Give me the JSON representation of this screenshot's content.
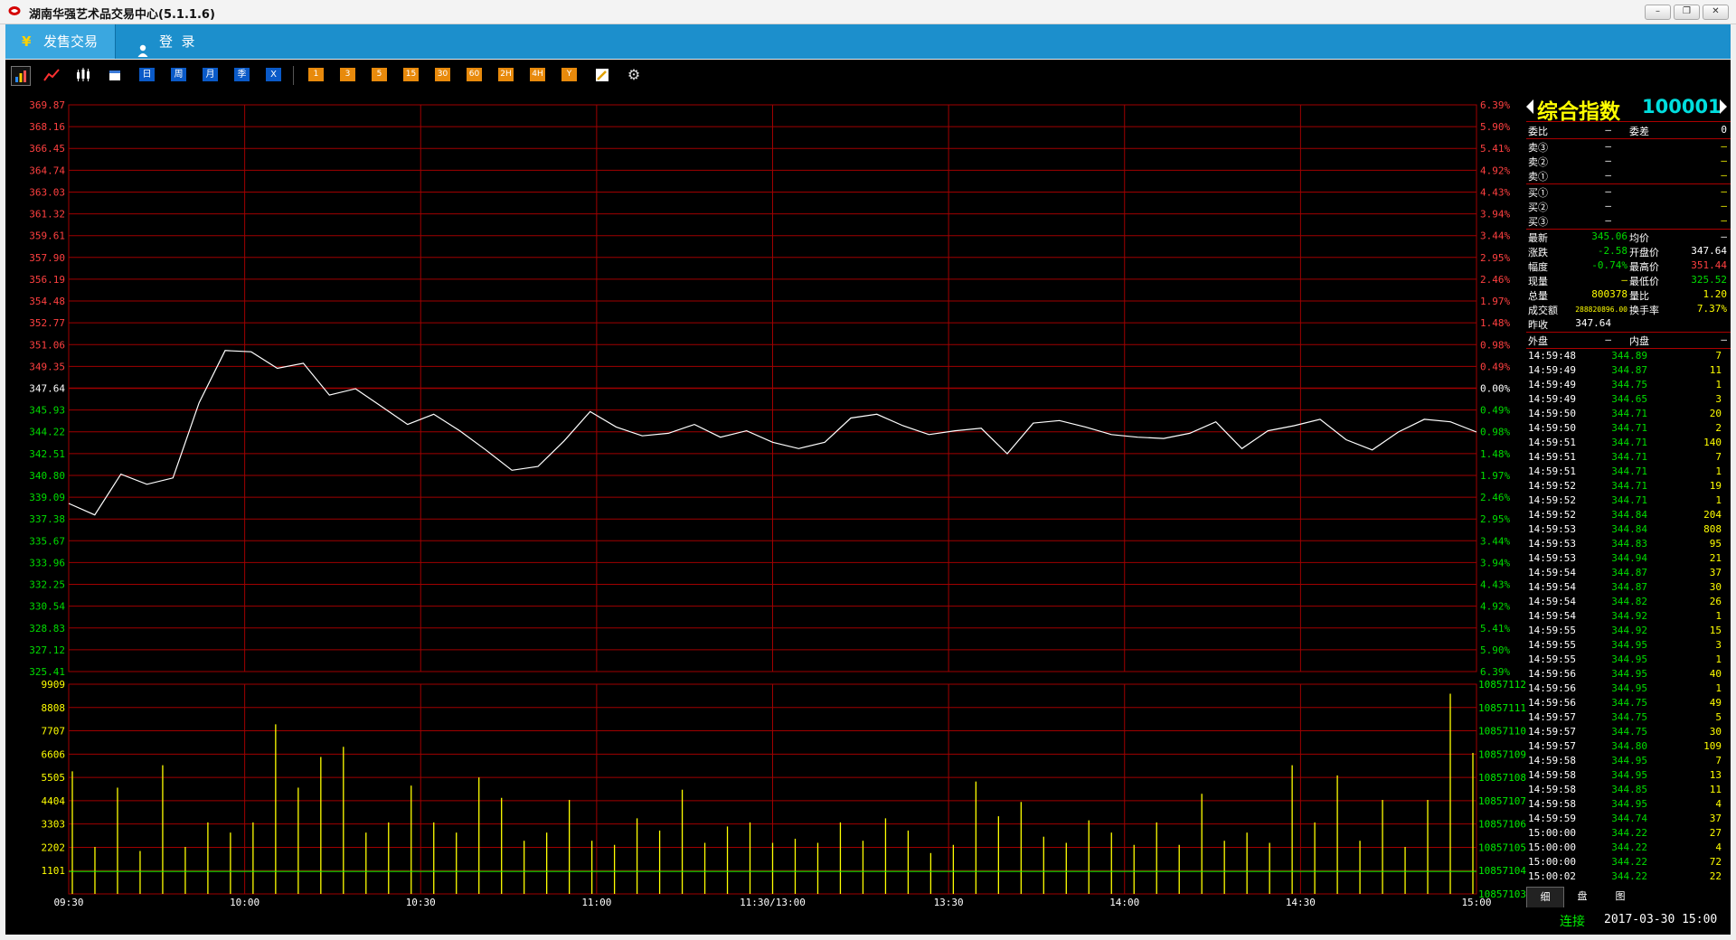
{
  "window": {
    "title": "湖南华强艺术品交易中心(5.1.1.6)",
    "controls": [
      "–",
      "❐",
      "✕"
    ]
  },
  "tabs": [
    {
      "label": "发售交易",
      "icon": "yen-icon"
    },
    {
      "label": "登  录",
      "icon": "user-icon"
    }
  ],
  "toolbar": {
    "period_buttons": [
      "日",
      "周",
      "月",
      "季",
      "X"
    ],
    "minute_buttons": [
      "1",
      "3",
      "5",
      "15",
      "30",
      "60",
      "2H",
      "4H",
      "Y"
    ]
  },
  "chart": {
    "price_ticks": [
      "369.87",
      "368.16",
      "366.45",
      "364.74",
      "363.03",
      "361.32",
      "359.61",
      "357.90",
      "356.19",
      "354.48",
      "352.77",
      "351.06",
      "349.35",
      "347.64",
      "345.93",
      "344.22",
      "342.51",
      "340.80",
      "339.09",
      "337.38",
      "335.67",
      "333.96",
      "332.25",
      "330.54",
      "328.83",
      "327.12",
      "325.41"
    ],
    "pct_ticks": [
      "6.39%",
      "5.90%",
      "5.41%",
      "4.92%",
      "4.43%",
      "3.94%",
      "3.44%",
      "2.95%",
      "2.46%",
      "1.97%",
      "1.48%",
      "0.98%",
      "0.49%",
      "0.00%",
      "0.49%",
      "0.98%",
      "1.48%",
      "1.97%",
      "2.46%",
      "2.95%",
      "3.44%",
      "3.94%",
      "4.43%",
      "4.92%",
      "5.41%",
      "5.90%",
      "6.39%"
    ],
    "vol_ticks": [
      "9909",
      "8808",
      "7707",
      "6606",
      "5505",
      "4404",
      "3303",
      "2202",
      "1101"
    ],
    "vol_right_ticks": [
      "10857112",
      "10857111",
      "10857110",
      "10857109",
      "10857108",
      "10857107",
      "10857106",
      "10857105",
      "10857104",
      "10857103"
    ],
    "time_ticks": [
      "09:30",
      "10:00",
      "10:30",
      "11:00",
      "11:30/13:00",
      "13:30",
      "14:00",
      "14:30",
      "15:00"
    ],
    "colors": {
      "up": "#ff4040",
      "down": "#00dd00",
      "flat": "#ffffff",
      "grid": "#a00000",
      "line": "#ffffff",
      "volume": "#ffff00",
      "volavg": "#00ff00"
    }
  },
  "chart_data": {
    "type": "line",
    "title": "综合指数 100001",
    "ylim": [
      325.41,
      369.87
    ],
    "prev_close": 347.64,
    "x": [
      "09:30",
      "10:00",
      "10:30",
      "11:00",
      "11:30/13:00",
      "13:30",
      "14:00",
      "14:30",
      "15:00"
    ],
    "series": [
      {
        "values": [
          338.6,
          337.7,
          340.9,
          340.1,
          340.6,
          346.5,
          350.6,
          350.5,
          349.2,
          349.6,
          347.1,
          347.6,
          346.2,
          344.8,
          345.6,
          344.3,
          342.8,
          341.2,
          341.5,
          343.5,
          345.8,
          344.6,
          343.9,
          344.1,
          344.8,
          343.8,
          344.3,
          343.4,
          342.9,
          343.4,
          345.3,
          345.6,
          344.7,
          344.0,
          344.3,
          344.5,
          342.5,
          344.9,
          345.1,
          344.6,
          344.0,
          343.8,
          343.7,
          344.1,
          345.0,
          342.9,
          344.3,
          344.7,
          345.2,
          343.6,
          342.8,
          344.2,
          345.2,
          345.0,
          344.2
        ]
      },
      {
        "name": "volume",
        "values": [
          6000,
          2300,
          5200,
          2100,
          6300,
          2300,
          3500,
          3000,
          3500,
          8300,
          5200,
          6700,
          7200,
          3000,
          3500,
          5300,
          3500,
          3000,
          5700,
          4700,
          2600,
          3000,
          4600,
          2600,
          2400,
          3700,
          3100,
          5100,
          2500,
          3300,
          3500,
          2500,
          2700,
          2500,
          3500,
          2600,
          3700,
          3100,
          2000,
          2400,
          5500,
          3800,
          4500,
          2800,
          2500,
          3600,
          3000,
          2400,
          3500,
          2400,
          4900,
          2600,
          3000,
          2500,
          6300,
          3500,
          5800,
          2600,
          4600,
          2300,
          4600,
          9800,
          6900
        ]
      }
    ]
  },
  "quote": {
    "title": "综合指数",
    "code": "100001",
    "wei": [
      {
        "k": "委比",
        "v": "—"
      },
      {
        "k": "委差",
        "v": "0"
      }
    ],
    "asks": [
      {
        "k": "卖③",
        "p": "—",
        "v": "—"
      },
      {
        "k": "卖②",
        "p": "—",
        "v": "—"
      },
      {
        "k": "卖①",
        "p": "—",
        "v": "—"
      }
    ],
    "bids": [
      {
        "k": "买①",
        "p": "—",
        "v": "—"
      },
      {
        "k": "买②",
        "p": "—",
        "v": "—"
      },
      {
        "k": "买③",
        "p": "—",
        "v": "—"
      }
    ],
    "stats": [
      {
        "k1": "最新",
        "v1": "345.06",
        "c1": "#00dd00",
        "k2": "均价",
        "v2": "—",
        "c2": "#fff"
      },
      {
        "k1": "涨跌",
        "v1": "-2.58",
        "c1": "#00dd00",
        "k2": "开盘价",
        "v2": "347.64",
        "c2": "#fff"
      },
      {
        "k1": "幅度",
        "v1": "-0.74%",
        "c1": "#00dd00",
        "k2": "最高价",
        "v2": "351.44",
        "c2": "#ff4040"
      },
      {
        "k1": "现量",
        "v1": "—",
        "c1": "#ffff00",
        "k2": "最低价",
        "v2": "325.52",
        "c2": "#00dd00"
      },
      {
        "k1": "总量",
        "v1": "800378",
        "c1": "#ffff00",
        "k2": "量比",
        "v2": "1.20",
        "c2": "#ffff00"
      },
      {
        "k1": "成交额",
        "v1": "288820896.00",
        "c1": "#ffff00",
        "k2": "换手率",
        "v2": "7.37%",
        "c2": "#ffff00"
      }
    ],
    "prev_close": {
      "k": "昨收",
      "v": "347.64"
    },
    "outer": {
      "k": "外盘",
      "v": "—"
    },
    "inner": {
      "k": "内盘",
      "v": "—"
    },
    "ticks": [
      {
        "t": "14:59:48",
        "p": "344.89",
        "v": "7"
      },
      {
        "t": "14:59:49",
        "p": "344.87",
        "v": "11"
      },
      {
        "t": "14:59:49",
        "p": "344.75",
        "v": "1"
      },
      {
        "t": "14:59:49",
        "p": "344.65",
        "v": "3"
      },
      {
        "t": "14:59:50",
        "p": "344.71",
        "v": "20"
      },
      {
        "t": "14:59:50",
        "p": "344.71",
        "v": "2"
      },
      {
        "t": "14:59:51",
        "p": "344.71",
        "v": "140"
      },
      {
        "t": "14:59:51",
        "p": "344.71",
        "v": "7"
      },
      {
        "t": "14:59:51",
        "p": "344.71",
        "v": "1"
      },
      {
        "t": "14:59:52",
        "p": "344.71",
        "v": "19"
      },
      {
        "t": "14:59:52",
        "p": "344.71",
        "v": "1"
      },
      {
        "t": "14:59:52",
        "p": "344.84",
        "v": "204"
      },
      {
        "t": "14:59:53",
        "p": "344.84",
        "v": "808"
      },
      {
        "t": "14:59:53",
        "p": "344.83",
        "v": "95"
      },
      {
        "t": "14:59:53",
        "p": "344.94",
        "v": "21"
      },
      {
        "t": "14:59:54",
        "p": "344.87",
        "v": "37"
      },
      {
        "t": "14:59:54",
        "p": "344.87",
        "v": "30"
      },
      {
        "t": "14:59:54",
        "p": "344.82",
        "v": "26"
      },
      {
        "t": "14:59:54",
        "p": "344.92",
        "v": "1"
      },
      {
        "t": "14:59:55",
        "p": "344.92",
        "v": "15"
      },
      {
        "t": "14:59:55",
        "p": "344.95",
        "v": "3"
      },
      {
        "t": "14:59:55",
        "p": "344.95",
        "v": "1"
      },
      {
        "t": "14:59:56",
        "p": "344.95",
        "v": "40"
      },
      {
        "t": "14:59:56",
        "p": "344.95",
        "v": "1"
      },
      {
        "t": "14:59:56",
        "p": "344.75",
        "v": "49"
      },
      {
        "t": "14:59:57",
        "p": "344.75",
        "v": "5"
      },
      {
        "t": "14:59:57",
        "p": "344.75",
        "v": "30"
      },
      {
        "t": "14:59:57",
        "p": "344.80",
        "v": "109"
      },
      {
        "t": "14:59:58",
        "p": "344.95",
        "v": "7"
      },
      {
        "t": "14:59:58",
        "p": "344.95",
        "v": "13"
      },
      {
        "t": "14:59:58",
        "p": "344.85",
        "v": "11"
      },
      {
        "t": "14:59:58",
        "p": "344.95",
        "v": "4"
      },
      {
        "t": "14:59:59",
        "p": "344.74",
        "v": "37"
      },
      {
        "t": "15:00:00",
        "p": "344.22",
        "v": "27"
      },
      {
        "t": "15:00:00",
        "p": "344.22",
        "v": "4"
      },
      {
        "t": "15:00:00",
        "p": "344.22",
        "v": "72"
      },
      {
        "t": "15:00:02",
        "p": "344.22",
        "v": "22"
      }
    ],
    "bottom_tabs": [
      "细",
      "盘",
      "图"
    ]
  },
  "status": {
    "connection": "连接",
    "datetime": "2017-03-30 15:00"
  }
}
